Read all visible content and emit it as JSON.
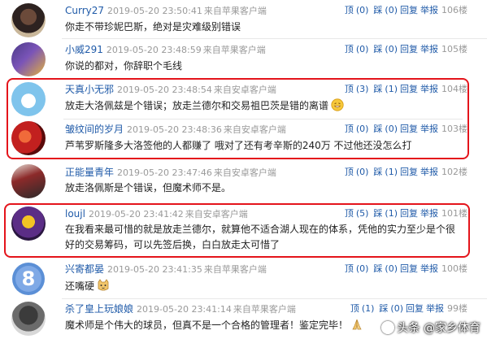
{
  "labels": {
    "top": "顶",
    "down": "踩",
    "reply": "回复",
    "report": "举报"
  },
  "comments": [
    {
      "user": "Curry27",
      "time": "2019-05-20 23:50:41",
      "source": "来自苹果客户端",
      "top": "(0)",
      "down": "(0)",
      "floor": "106楼",
      "text": "你走不带珍妮巴斯，绝对是灾难级别错误"
    },
    {
      "user": "小威291",
      "time": "2019-05-20 23:48:59",
      "source": "来自苹果客户端",
      "top": "(0)",
      "down": "(0)",
      "floor": "105楼",
      "text": "你说的都对，你辞职个毛线"
    },
    {
      "user": "天真小无邪",
      "time": "2019-05-20 23:48:54",
      "source": "来自安卓客户端",
      "top": "(3)",
      "down": "(1)",
      "floor": "104楼",
      "text": "放走大洛佩兹是个错误；放走兰德尔和交易祖巴茨是错的离谱"
    },
    {
      "user": "皱纹间的岁月",
      "time": "2019-05-20 23:48:36",
      "source": "来自安卓客户端",
      "top": "(0)",
      "down": "(0)",
      "floor": "103楼",
      "text": "芦苇罗斯隆多大洛签他的人都赚了 哦对了还有考辛斯的240万 不过他还没怎么打"
    },
    {
      "user": "正能量青年",
      "time": "2019-05-20 23:47:46",
      "source": "来自安卓客户端",
      "top": "(0)",
      "down": "(1)",
      "floor": "102楼",
      "text": "放走洛佩斯是个错误，但魔术师不是。"
    },
    {
      "user": "loujl",
      "time": "2019-05-20 23:41:42",
      "source": "来自安卓客户端",
      "top": "(5)",
      "down": "(1)",
      "floor": "101楼",
      "text": "在我看来最可惜的就是放走兰德尔，就算他不适合湖人现在的体系，凭他的实力至少是个很好的交易筹码，可以先签后换，白白放走太可惜了"
    },
    {
      "user": "兴寄都晏",
      "time": "2019-05-20 23:41:35",
      "source": "来自苹果客户端",
      "top": "(0)",
      "down": "(0)",
      "floor": "100楼",
      "text": "还嘴硬"
    },
    {
      "user": "杀了皇上玩娘娘",
      "time": "2019-05-20 23:41:14",
      "source": "来自苹果客户端",
      "top": "(1)",
      "down": "(0)",
      "floor": "99楼",
      "text": "魔术师是个伟大的球员，但真不是一个合格的管理者！鉴定完毕！"
    }
  ],
  "watermark": "头条 @家乡体育"
}
